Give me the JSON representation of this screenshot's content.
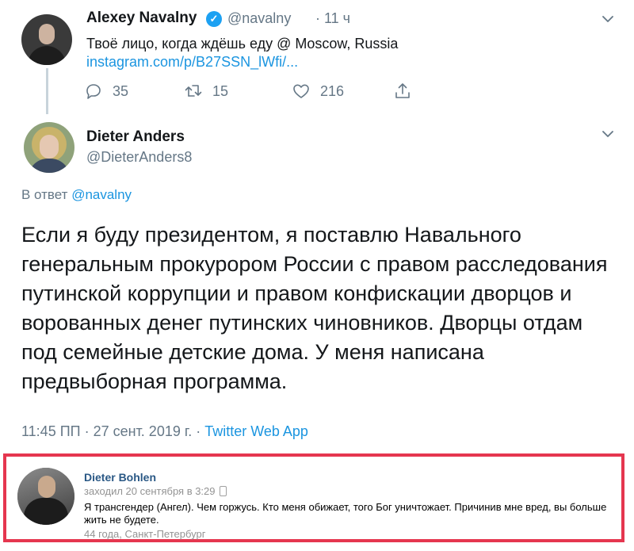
{
  "tweet1": {
    "name": "Alexey Navalny",
    "handle": "@navalny",
    "time": "· 11 ч",
    "text": "Твоё лицо, когда ждёшь еду @ Moscow, Russia",
    "link": "instagram.com/p/B27SSN_lWfi/...",
    "replies": "35",
    "retweets": "15",
    "likes": "216"
  },
  "tweet2": {
    "name": "Dieter Anders",
    "handle": "@DieterAnders8",
    "reply_prefix": "В ответ",
    "reply_handle": "@navalny",
    "text": "Если я буду президентом, я поставлю Навального генеральным прокурором России с правом расследования путинской коррупции и правом конфискации дворцов и ворованных денег путинских чиновников. Дворцы отдам под семейные детские дома. У меня написана предвыборная программа.",
    "timestamp": "11:45 ПП · 27 сент. 2019 г. · ",
    "client": "Twitter Web App"
  },
  "vk": {
    "name": "Dieter Bohlen",
    "status": "заходил 20 сентября в 3:29",
    "text": "Я трансгендер (Ангел). Чем горжусь. Кто меня обижает, того Бог уничтожает. Причинив мне вред, вы больше жить не будете.",
    "location": "44 года, Санкт-Петербург",
    "highlight_color": "#e5364f"
  },
  "colors": {
    "link": "#1b95e0",
    "muted": "#657786",
    "verified": "#1da1f2"
  }
}
